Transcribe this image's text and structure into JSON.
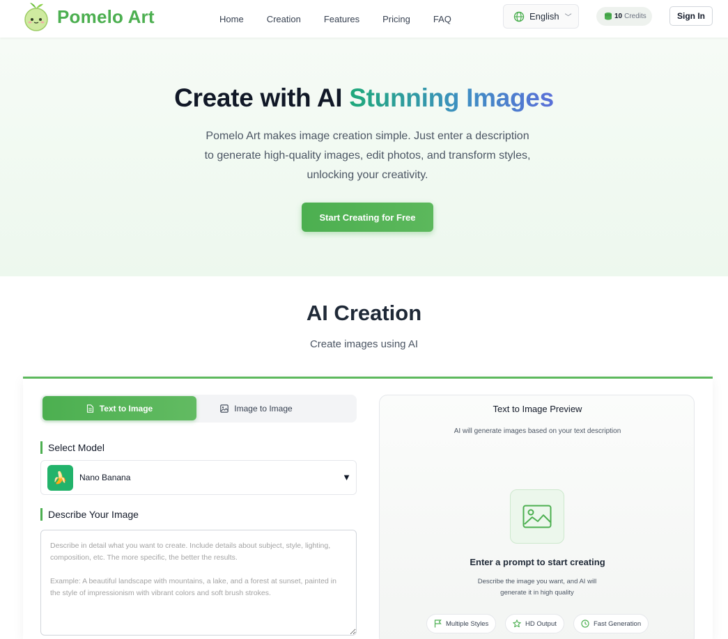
{
  "brand": {
    "name": "Pomelo Art",
    "accent": "#4caf50"
  },
  "nav": [
    {
      "label": "Home"
    },
    {
      "label": "Creation"
    },
    {
      "label": "Features"
    },
    {
      "label": "Pricing"
    },
    {
      "label": "FAQ"
    }
  ],
  "header": {
    "language": "English",
    "credits_count": "10",
    "credits_unit": "Credits",
    "signin_label": "Sign In"
  },
  "hero": {
    "title_plain": "Create with AI",
    "title_gradient": "Stunning Images",
    "description": "Pomelo Art makes image creation simple. Just enter a description to generate high-quality images, edit photos, and transform styles, unlocking your creativity.",
    "cta_label": "Start Creating for Free"
  },
  "section": {
    "title": "AI Creation",
    "subtitle": "Create images using AI"
  },
  "tabs": [
    {
      "label": "Text to Image",
      "active": true,
      "icon": "document-icon"
    },
    {
      "label": "Image to Image",
      "active": false,
      "icon": "image-icon"
    }
  ],
  "model": {
    "label": "Select Model",
    "selected": "Nano Banana",
    "icon": "banana-icon",
    "emoji": "🍌"
  },
  "prompt": {
    "label": "Describe Your Image",
    "placeholder": "Describe in detail what you want to create. Include details about subject, style, lighting, composition, etc. The more specific, the better the results.\n\nExample: A beautiful landscape with mountains, a lake, and a forest at sunset, painted in the style of impressionism with vibrant colors and soft brush strokes.",
    "value": ""
  },
  "preview": {
    "title": "Text to Image Preview",
    "subtitle": "AI will generate images based on your text description",
    "heading": "Enter a prompt to start creating",
    "description": "Describe the image you want, and AI will generate it in high quality",
    "features": [
      {
        "label": "Multiple Styles",
        "icon": "flag-icon"
      },
      {
        "label": "HD Output",
        "icon": "star-icon"
      },
      {
        "label": "Fast Generation",
        "icon": "clock-icon"
      }
    ]
  }
}
